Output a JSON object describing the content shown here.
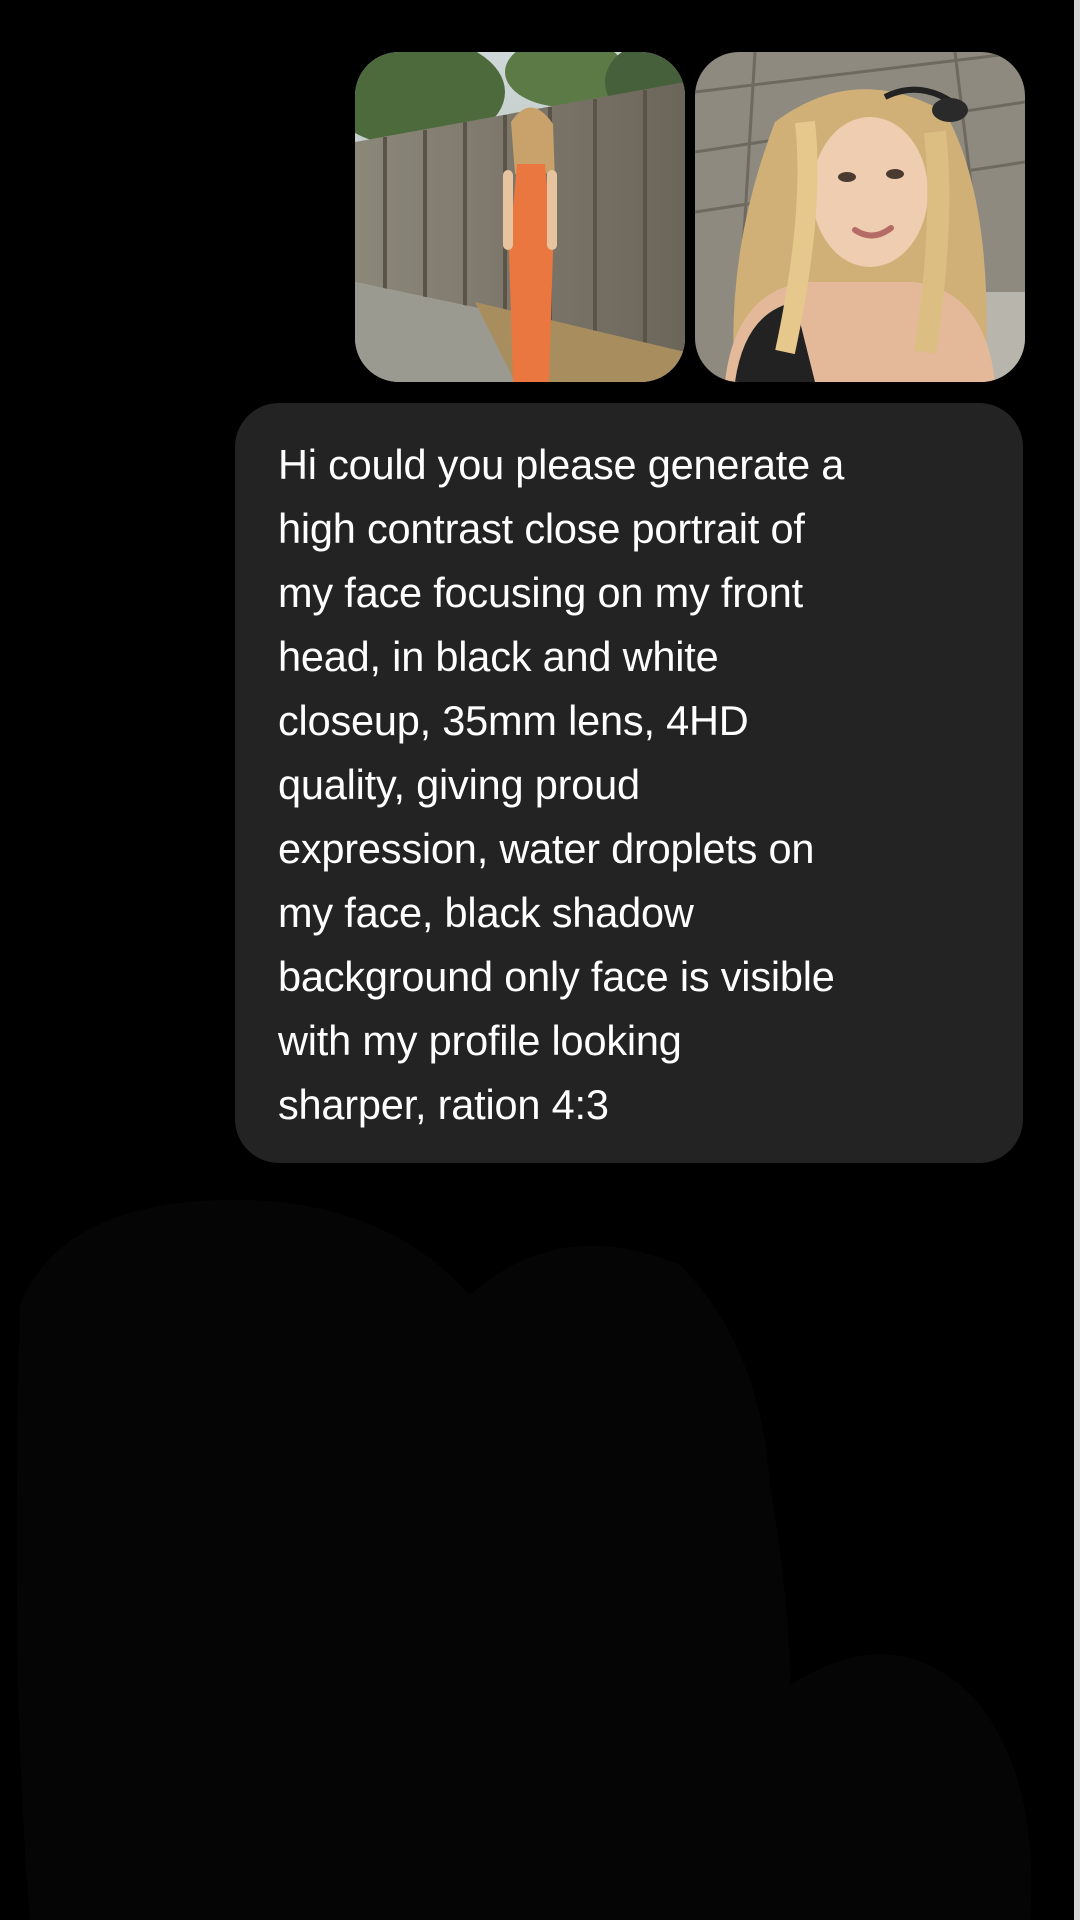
{
  "thread": {
    "attachments": [
      {
        "name": "photo-orange-dress",
        "alt": "Photo of a woman in an orange dress by a fence"
      },
      {
        "name": "photo-selfie",
        "alt": "Selfie of a woman with long blonde hair"
      }
    ],
    "message": {
      "lines": [
        "Hi could you please generate a",
        "high contrast close portrait of",
        "my face focusing on my front",
        "head, in black and white",
        "closeup, 35mm lens, 4HD",
        "quality, giving proud",
        "expression, water droplets on",
        "my face, black shadow",
        "background only face is visible",
        "with my profile looking",
        "sharper, ration 4:3"
      ]
    }
  },
  "colors": {
    "background": "#000000",
    "bubble": "#232323",
    "text": "#ffffff"
  }
}
